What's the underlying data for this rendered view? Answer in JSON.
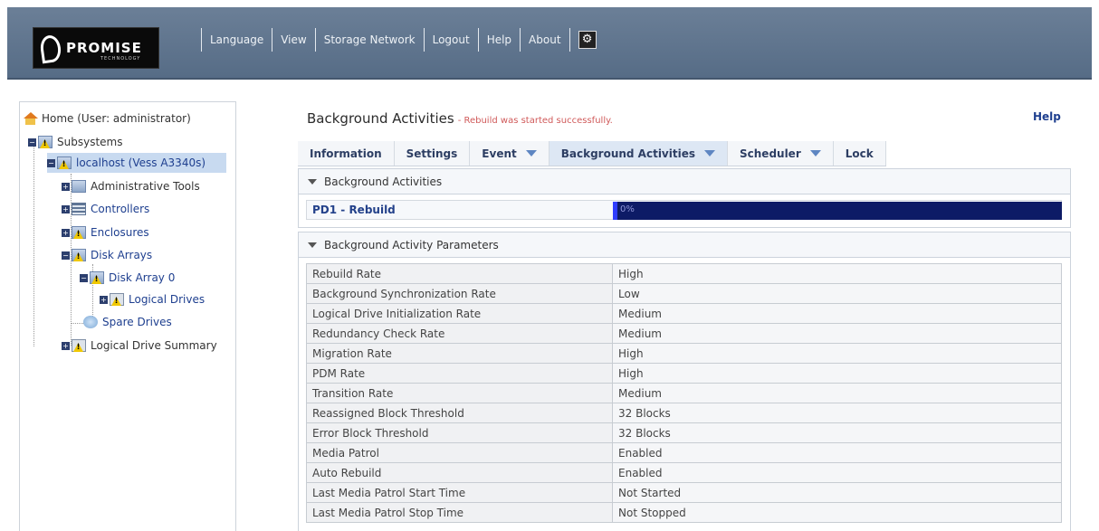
{
  "header": {
    "logo_text": "PROMISE",
    "logo_subtext": "TECHNOLOGY",
    "nav": [
      "Language",
      "View",
      "Storage Network",
      "Logout",
      "Help",
      "About"
    ]
  },
  "tree": {
    "home": "Home (User: administrator)",
    "subsystems": "Subsystems",
    "host": "localhost (Vess A3340s)",
    "admin_tools": "Administrative Tools",
    "controllers": "Controllers",
    "enclosures": "Enclosures",
    "disk_arrays": "Disk Arrays",
    "disk_array_0": "Disk Array 0",
    "logical_drives": "Logical Drives",
    "spare_drives": "Spare Drives",
    "ld_summary": "Logical Drive Summary"
  },
  "page": {
    "title": "Background Activities",
    "message": "- Rebuild was started successfully.",
    "help": "Help"
  },
  "tabs": [
    {
      "label": "Information",
      "dropdown": false,
      "active": false
    },
    {
      "label": "Settings",
      "dropdown": false,
      "active": false
    },
    {
      "label": "Event",
      "dropdown": true,
      "active": false
    },
    {
      "label": "Background Activities",
      "dropdown": true,
      "active": true
    },
    {
      "label": "Scheduler",
      "dropdown": true,
      "active": false
    },
    {
      "label": "Lock",
      "dropdown": false,
      "active": false
    }
  ],
  "activities": {
    "heading": "Background Activities",
    "item_label": "PD1 - Rebuild",
    "progress_text": "0%",
    "progress_fraction": 0.01
  },
  "parameters": {
    "heading": "Background Activity Parameters",
    "rows": [
      [
        "Rebuild Rate",
        "High"
      ],
      [
        "Background Synchronization Rate",
        "Low"
      ],
      [
        "Logical Drive Initialization Rate",
        "Medium"
      ],
      [
        "Redundancy Check Rate",
        "Medium"
      ],
      [
        "Migration Rate",
        "High"
      ],
      [
        "PDM Rate",
        "High"
      ],
      [
        "Transition Rate",
        "Medium"
      ],
      [
        "Reassigned Block Threshold",
        "32 Blocks"
      ],
      [
        "Error Block Threshold",
        "32 Blocks"
      ],
      [
        "Media Patrol",
        "Enabled"
      ],
      [
        "Auto Rebuild",
        "Enabled"
      ],
      [
        "Last Media Patrol Start Time",
        "Not Started"
      ],
      [
        "Last Media Patrol Stop Time",
        "Not Stopped"
      ]
    ]
  },
  "colors": {
    "header_bg": "#566c86",
    "link": "#1e3f8f",
    "progress_bg": "#0d1b66",
    "progress_fill": "#2f3dff",
    "message": "#d05a5a"
  }
}
